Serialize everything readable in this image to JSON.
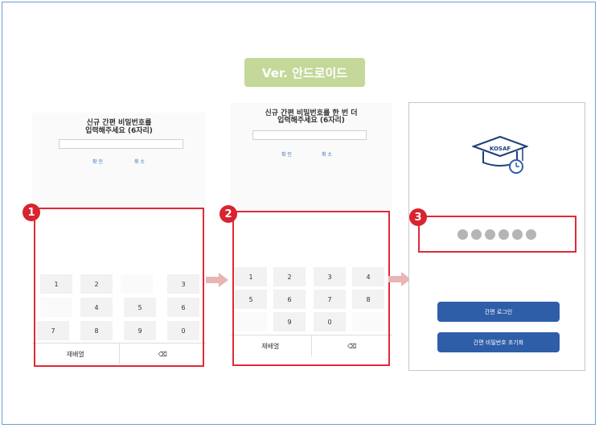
{
  "version_badge": "Ver. 안드로이드",
  "steps": [
    "1",
    "2",
    "3"
  ],
  "screen1": {
    "prompt_line1": "신규 간편 비밀번호를",
    "prompt_line2": "입력해주세요 (6자리)",
    "confirm_label": "확 인",
    "cancel_label": "취 소",
    "keys": [
      "1",
      "2",
      "3",
      "4",
      "5",
      "6",
      "7",
      "8",
      "9",
      "0"
    ],
    "rearrange_label": "재배열",
    "backspace_label": "⌫"
  },
  "screen2": {
    "prompt_line1": "신규 간편 비밀번호를 한 번 더",
    "prompt_line2": "입력해주세요 (6자리)",
    "confirm_label": "확 인",
    "cancel_label": "취 소",
    "keys": [
      "1",
      "2",
      "3",
      "4",
      "5",
      "6",
      "7",
      "8",
      "9",
      "0"
    ],
    "rearrange_label": "재배열",
    "backspace_label": "⌫"
  },
  "screen3": {
    "logo_text": "KOSAF",
    "pin_dots": 6,
    "simple_login_label": "간편 로그인",
    "reset_label": "간편 비밀번호 초기화"
  },
  "colors": {
    "frame": "#6a9fd4",
    "badge": "#c4d89a",
    "highlight": "#e02a36",
    "button": "#2f5ea8",
    "arrow": "#e8b4b4"
  }
}
